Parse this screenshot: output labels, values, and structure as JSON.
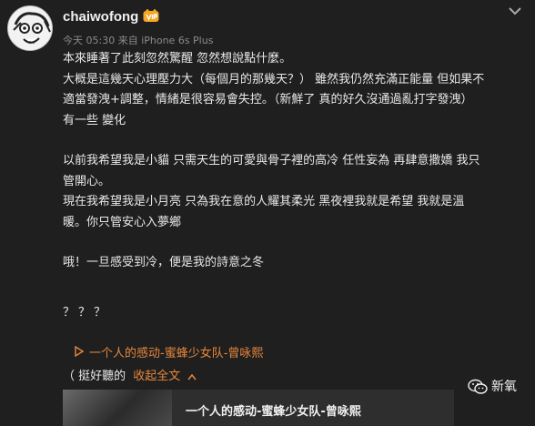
{
  "user": {
    "name": "chaiwofong",
    "timestamp": "今天 05:30",
    "source": "来自 iPhone 6s Plus"
  },
  "post": {
    "lines": [
      "本來睡著了此刻忽然驚醒 忽然想說點什麼。",
      "大概是這幾天心理壓力大（每個月的那幾天？） 雖然我仍然充滿正能量 但如果不",
      "適當發洩+調整，情緒是很容易會失控。（新鮮了 真的好久沒通過亂打字發洩）",
      "有一些 變化",
      "以前我希望我是小貓 只需天生的可愛與骨子裡的高冷 任性妄為 再肆意撒嬌 我只",
      "管開心。",
      "現在我希望我是小月亮 只為我在意的人耀其柔光 黑夜裡我就是希望 我就是溫",
      "暖。你只管安心入夢鄉",
      "哦！一旦感受到冷，便是我的詩意之冬",
      "？？？"
    ]
  },
  "music": {
    "link_text": "一个人的感动-蜜蜂少女队-曾咏熙"
  },
  "expand": {
    "prefix": "（ 挺好聽的",
    "collapse_label": "收起全文"
  },
  "card": {
    "title": "一个人的感动-蜜蜂少女队-曾咏熙"
  },
  "watermark": {
    "text": "新氧"
  },
  "colors": {
    "background": "#1f1f1f",
    "accent": "#e8873b",
    "text": "#e8e8e8",
    "meta": "#8a8a8a"
  },
  "icons": [
    "avatar",
    "vip-badge-icon",
    "chevron-down-icon",
    "play-triangle-icon",
    "caret-up-icon",
    "wechat-icon"
  ]
}
